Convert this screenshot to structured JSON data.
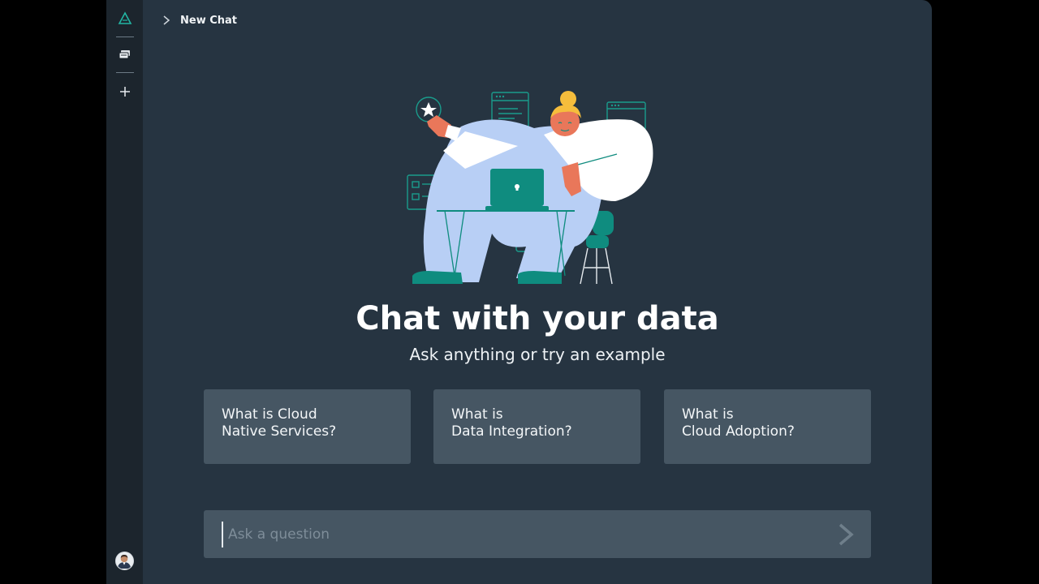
{
  "sidebar": {
    "icons": [
      "logo-triangle-icon",
      "chats-icon",
      "plus-icon",
      "avatar"
    ]
  },
  "header": {
    "title": "New Chat"
  },
  "hero": {
    "headline": "Chat with your data",
    "subline": "Ask anything or try an example"
  },
  "examples": [
    {
      "line1": "What is Cloud",
      "line2": "Native Services?"
    },
    {
      "line1": "What is",
      "line2": "Data Integration?"
    },
    {
      "line1": "What is",
      "line2": "Cloud Adoption?"
    }
  ],
  "ask": {
    "placeholder": "Ask a question",
    "value": ""
  },
  "colors": {
    "background": "#000000",
    "rail": "#1c252d",
    "panel": "#263441",
    "card": "#465663",
    "accent": "#0f8c7f",
    "figure_blue": "#b8cff5",
    "skin": "#e9775a",
    "hair": "#f5bd3c"
  }
}
